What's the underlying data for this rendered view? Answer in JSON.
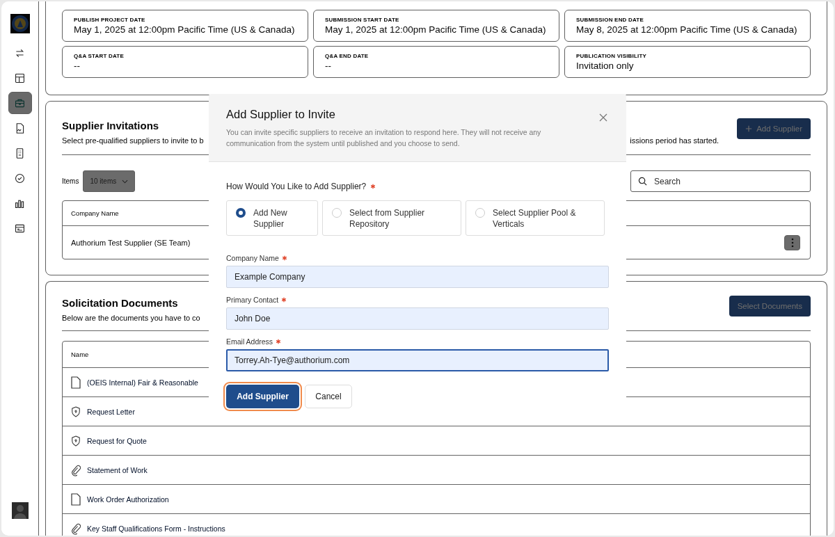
{
  "sidebar": {
    "items": [
      {
        "selected": false
      },
      {
        "selected": false
      },
      {
        "selected": true
      },
      {
        "selected": false
      },
      {
        "selected": false
      },
      {
        "selected": false
      },
      {
        "selected": false
      },
      {
        "selected": false
      }
    ]
  },
  "project_dates": [
    {
      "label": "PUBLISH PROJECT DATE",
      "value": "May 1, 2025 at 12:00pm Pacific Time (US & Canada)"
    },
    {
      "label": "SUBMISSION START DATE",
      "value": "May 1, 2025 at 12:00pm Pacific Time (US & Canada)"
    },
    {
      "label": "SUBMISSION END DATE",
      "value": "May 8, 2025 at 12:00pm Pacific Time (US & Canada)"
    },
    {
      "label": "Q&A START DATE",
      "value": "--"
    },
    {
      "label": "Q&A END DATE",
      "value": "--"
    },
    {
      "label": "PUBLICATION VISIBILITY",
      "value": "Invitation only"
    }
  ],
  "supplier_invitations": {
    "title": "Supplier Invitations",
    "description_start": "Select pre-qualified suppliers to invite to b",
    "description_end": "issions period has started.",
    "add_button": "Add Supplier",
    "items_label": "Items",
    "items_select": "10 items",
    "search_placeholder": "Search",
    "table": {
      "columns": [
        "Company Name"
      ],
      "rows": [
        [
          "Authorium Test Supplier (SE Team)"
        ]
      ]
    }
  },
  "solicitation_documents": {
    "title": "Solicitation Documents",
    "description": "Below are the documents you have to co",
    "select_button": "Select Documents",
    "table": {
      "columns": [
        "Name"
      ],
      "rows": [
        {
          "name": "(OEIS Internal) Fair & Reasonable",
          "kind": "document"
        },
        {
          "name": "Request Letter",
          "kind": "protected"
        },
        {
          "name": "Request for Quote",
          "kind": "protected"
        },
        {
          "name": "Statement of Work",
          "kind": "attachment"
        },
        {
          "name": "Work Order Authorization",
          "kind": "document"
        },
        {
          "name": "Key Staff Qualifications Form - Instructions",
          "kind": "attachment"
        }
      ]
    }
  },
  "modal": {
    "title": "Add Supplier to Invite",
    "description": "You can invite specific suppliers to receive an invitation to respond here. They will not receive any communication from the system until published and you choose to send.",
    "question": "How Would You Like to Add Supplier?",
    "question_required": true,
    "options": [
      {
        "label": "Add New Supplier",
        "selected": true
      },
      {
        "label": "Select from Supplier Repository",
        "selected": false
      },
      {
        "label": "Select Supplier Pool & Verticals",
        "selected": false
      }
    ],
    "fields": [
      {
        "label": "Company Name",
        "value": "Example Company",
        "required": true,
        "focused": false
      },
      {
        "label": "Primary Contact",
        "value": "John Doe",
        "required": true,
        "focused": false
      },
      {
        "label": "Email Address",
        "value": "Torrey.Ah-Tye@authorium.com",
        "required": true,
        "focused": true
      }
    ],
    "buttons": [
      {
        "label": "Add Supplier",
        "kind": "primary",
        "focused": true
      },
      {
        "label": "Cancel",
        "kind": "secondary",
        "focused": false
      }
    ]
  }
}
